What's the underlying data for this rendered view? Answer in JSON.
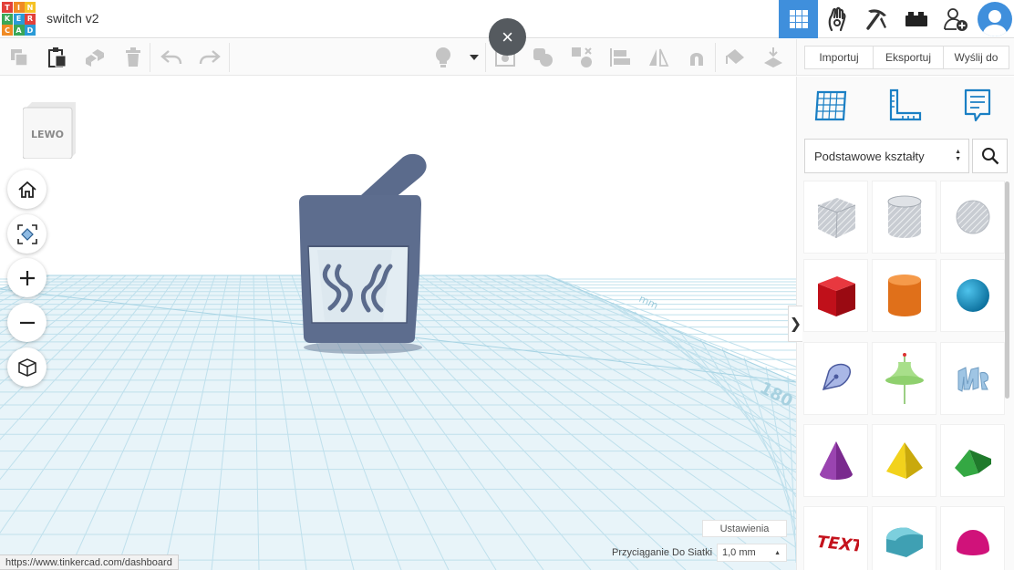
{
  "app": {
    "logo_letters": [
      "T",
      "I",
      "N",
      "K",
      "E",
      "R",
      "C",
      "A",
      "D"
    ],
    "logo_colors": [
      "#e2413a",
      "#f08a24",
      "#f5c225",
      "#3aa757",
      "#2a9bd7",
      "#e2413a",
      "#f08a24",
      "#3aa757",
      "#2a9bd7"
    ],
    "doc_title": "switch v2",
    "close_glyph": "×",
    "accent": "#3f8fdc"
  },
  "top_icons": [
    {
      "name": "3d-design-grid-icon",
      "active": true
    },
    {
      "name": "circuits-hand-icon",
      "active": false
    },
    {
      "name": "codeblocks-pickaxe-icon",
      "active": false
    },
    {
      "name": "bricks-icon",
      "active": false
    },
    {
      "name": "add-user-icon",
      "active": false
    },
    {
      "name": "avatar-icon",
      "active": false
    }
  ],
  "toolbar": {
    "tools": [
      "copy-icon",
      "paste-icon",
      "duplicate-icon",
      "delete-icon",
      "undo-icon",
      "redo-icon",
      "lightbulb-icon",
      "dropdown-caret-icon",
      "note-icon",
      "group-icon",
      "ungroup-icon",
      "align-icon",
      "mirror-icon",
      "magnet-icon",
      "paint-icon",
      "drop-icon"
    ]
  },
  "right_top": {
    "import_label": "Importuj",
    "export_label": "Eksportuj",
    "send_label": "Wyślij do"
  },
  "viewport": {
    "view_cube_label": "LEWO",
    "nav_buttons": [
      "home-icon",
      "fit-view-icon",
      "zoom-in-icon",
      "zoom-out-icon",
      "perspective-cube-icon"
    ],
    "collapse_glyph": "❯",
    "settings_label": "Ustawienia",
    "snap_label": "Przyciąganie Do Siatki",
    "snap_value": "1,0 mm",
    "snap_caret": "▲",
    "status_url": "https://www.tinkercad.com/dashboard",
    "plane_color": "#e8f4f9",
    "grid_color": "#bfe0ec",
    "model_color": "#5b6b8c"
  },
  "panel": {
    "tools": [
      "workplane-icon",
      "ruler-icon",
      "notes-icon"
    ],
    "shapes_select": "Podstawowe kształty",
    "shapes": [
      "box-hole-icon",
      "cylinder-hole-icon",
      "sphere-hole-icon",
      "box-icon",
      "cylinder-icon",
      "sphere-icon",
      "scribble-icon",
      "torus-paraboloid-icon",
      "text-shape-icon",
      "cone-icon",
      "pyramid-icon",
      "roof-icon",
      "text-icon",
      "half-cylinder-icon",
      "half-sphere-icon"
    ]
  }
}
